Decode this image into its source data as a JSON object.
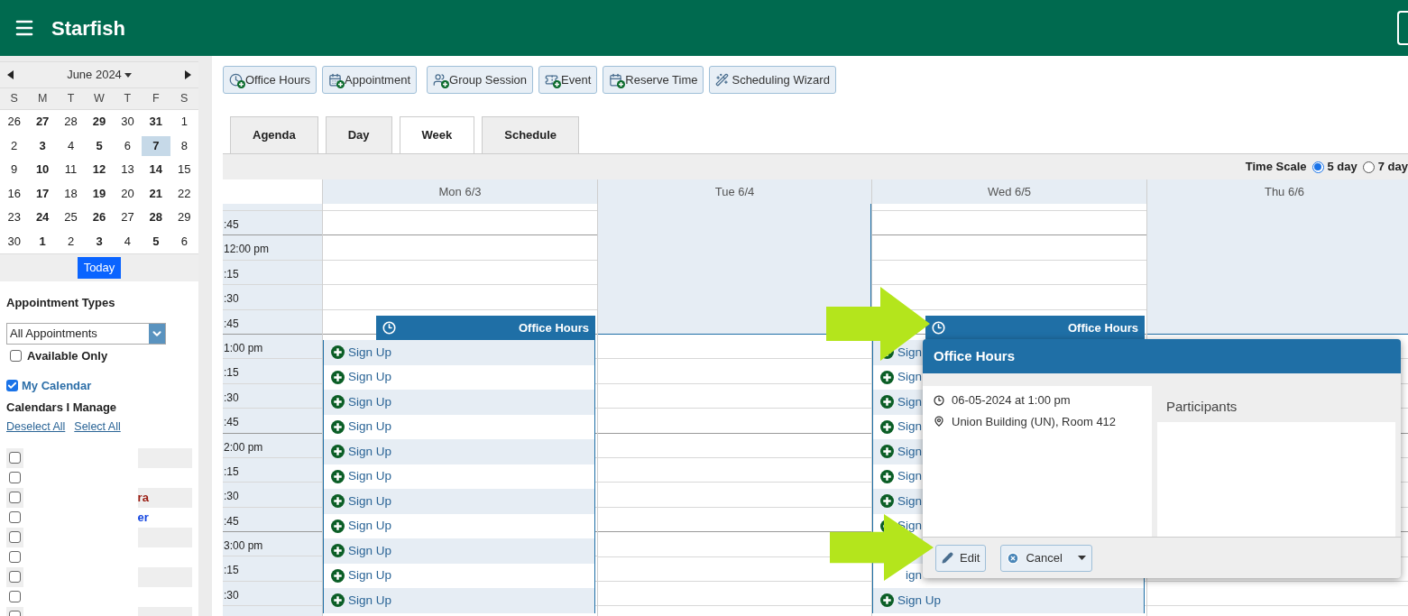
{
  "header": {
    "title": "Starfish"
  },
  "mini_calendar": {
    "month": "June 2024",
    "weekdays": [
      "S",
      "M",
      "T",
      "W",
      "T",
      "F",
      "S"
    ],
    "weeks": [
      [
        {
          "day": "26",
          "bold": false,
          "selected": false
        },
        {
          "day": "27",
          "bold": true,
          "selected": false
        },
        {
          "day": "28",
          "bold": false,
          "selected": false
        },
        {
          "day": "29",
          "bold": true,
          "selected": false
        },
        {
          "day": "30",
          "bold": false,
          "selected": false
        },
        {
          "day": "31",
          "bold": true,
          "selected": false
        },
        {
          "day": "1",
          "bold": false,
          "selected": false
        }
      ],
      [
        {
          "day": "2",
          "bold": false,
          "selected": false
        },
        {
          "day": "3",
          "bold": true,
          "selected": false
        },
        {
          "day": "4",
          "bold": false,
          "selected": false
        },
        {
          "day": "5",
          "bold": true,
          "selected": false
        },
        {
          "day": "6",
          "bold": false,
          "selected": false
        },
        {
          "day": "7",
          "bold": true,
          "selected": true
        },
        {
          "day": "8",
          "bold": false,
          "selected": false
        }
      ],
      [
        {
          "day": "9",
          "bold": false,
          "selected": false
        },
        {
          "day": "10",
          "bold": true,
          "selected": false
        },
        {
          "day": "11",
          "bold": false,
          "selected": false
        },
        {
          "day": "12",
          "bold": true,
          "selected": false
        },
        {
          "day": "13",
          "bold": false,
          "selected": false
        },
        {
          "day": "14",
          "bold": true,
          "selected": false
        },
        {
          "day": "15",
          "bold": false,
          "selected": false
        }
      ],
      [
        {
          "day": "16",
          "bold": false,
          "selected": false
        },
        {
          "day": "17",
          "bold": true,
          "selected": false
        },
        {
          "day": "18",
          "bold": false,
          "selected": false
        },
        {
          "day": "19",
          "bold": true,
          "selected": false
        },
        {
          "day": "20",
          "bold": false,
          "selected": false
        },
        {
          "day": "21",
          "bold": true,
          "selected": false
        },
        {
          "day": "22",
          "bold": false,
          "selected": false
        }
      ],
      [
        {
          "day": "23",
          "bold": false,
          "selected": false
        },
        {
          "day": "24",
          "bold": true,
          "selected": false
        },
        {
          "day": "25",
          "bold": false,
          "selected": false
        },
        {
          "day": "26",
          "bold": true,
          "selected": false
        },
        {
          "day": "27",
          "bold": false,
          "selected": false
        },
        {
          "day": "28",
          "bold": true,
          "selected": false
        },
        {
          "day": "29",
          "bold": false,
          "selected": false
        }
      ],
      [
        {
          "day": "30",
          "bold": false,
          "selected": false
        },
        {
          "day": "1",
          "bold": true,
          "selected": false
        },
        {
          "day": "2",
          "bold": false,
          "selected": false
        },
        {
          "day": "3",
          "bold": true,
          "selected": false
        },
        {
          "day": "4",
          "bold": false,
          "selected": false
        },
        {
          "day": "5",
          "bold": true,
          "selected": false
        },
        {
          "day": "6",
          "bold": false,
          "selected": false
        }
      ]
    ],
    "today_button": "Today"
  },
  "filters": {
    "heading": "Appointment Types",
    "select": {
      "value": "All Appointments"
    },
    "available_only": {
      "label": "Available Only",
      "checked": false
    },
    "my_calendar": {
      "label": "My Calendar",
      "checked": true
    },
    "calendars_heading": "Calendars I Manage",
    "links": [
      "Deselect All",
      "Select All"
    ],
    "calendars": [
      {
        "checked": false
      },
      {
        "checked": false
      },
      {
        "checked": false,
        "label": "ra",
        "color": "#9a1c12"
      },
      {
        "checked": false,
        "label": "er",
        "color": "#1446e0"
      },
      {
        "checked": false
      },
      {
        "checked": false
      },
      {
        "checked": false
      },
      {
        "checked": false
      },
      {
        "checked": false
      }
    ]
  },
  "toolbar": [
    "Office Hours",
    "Appointment",
    "Group Session",
    "Event",
    "Reserve Time",
    "Scheduling Wizard"
  ],
  "view_tabs": [
    {
      "label": "Agenda",
      "selected": false
    },
    {
      "label": "Day",
      "selected": false
    },
    {
      "label": "Week",
      "selected": true
    },
    {
      "label": "Schedule",
      "selected": false
    }
  ],
  "time_scale": {
    "label": "Time Scale",
    "options": [
      {
        "label": "5 day",
        "selected": true
      },
      {
        "label": "7 day",
        "selected": false
      }
    ]
  },
  "times": [
    ":45",
    "12:00 pm",
    ":15",
    ":30",
    ":45",
    "1:00 pm",
    ":15",
    ":30",
    ":45",
    "2:00 pm",
    ":15",
    ":30",
    ":45",
    "3:00 pm",
    ":15",
    ":30"
  ],
  "days": [
    {
      "label": "Mon 6/3",
      "shaded_morning": false,
      "event": {
        "title": "Office Hours",
        "slots": [
          {
            "kind": "slot",
            "label": "Sign Up"
          },
          {
            "kind": "slot",
            "label": "Sign Up"
          },
          {
            "kind": "slot",
            "label": "Sign Up"
          },
          {
            "kind": "slot",
            "label": "Sign Up"
          },
          {
            "kind": "slot",
            "label": "Sign Up"
          },
          {
            "kind": "slot",
            "label": "Sign Up"
          },
          {
            "kind": "slot",
            "label": "Sign Up"
          },
          {
            "kind": "slot",
            "label": "Sign Up"
          },
          {
            "kind": "slot",
            "label": "Sign Up"
          },
          {
            "kind": "slot",
            "label": "Sign Up"
          },
          {
            "kind": "slot",
            "label": "Sign Up"
          }
        ]
      }
    },
    {
      "label": "Tue 6/4",
      "shaded_morning": true
    },
    {
      "label": "Wed 6/5",
      "shaded_morning": false,
      "event": {
        "title": "Office Hours",
        "slots": [
          {
            "kind": "slot",
            "label": "Sign"
          },
          {
            "kind": "slot",
            "label": "Sign"
          },
          {
            "kind": "slot",
            "label": "Sign"
          },
          {
            "kind": "slot",
            "label": "Sign"
          },
          {
            "kind": "slot",
            "label": "Sign"
          },
          {
            "kind": "slot",
            "label": "Sign"
          },
          {
            "kind": "slot",
            "label": "Sign"
          },
          {
            "kind": "slot",
            "label": "Sign"
          },
          {
            "kind": "covered"
          },
          {
            "kind": "partial",
            "label": "ign"
          },
          {
            "kind": "slot",
            "label": "Sign Up"
          }
        ]
      }
    },
    {
      "label": "Thu 6/6",
      "shaded_morning": true
    }
  ],
  "popup": {
    "title": "Office Hours",
    "datetime": "06-05-2024 at 1:00 pm",
    "location": "Union Building (UN), Room 412",
    "participants_heading": "Participants",
    "buttons": [
      "Edit",
      "Cancel"
    ]
  }
}
